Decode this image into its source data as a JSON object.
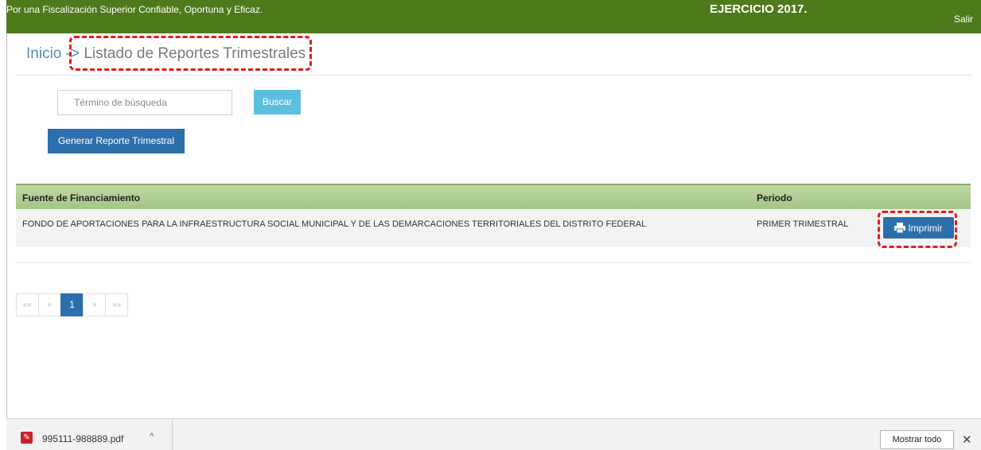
{
  "header": {
    "slogan": "Por una Fiscalización Superior Confiable, Oportuna y Eficaz.",
    "ejercicio": "EJERCICIO 2017.",
    "logout_label": "Salir",
    "background_color": "#4f7a1c"
  },
  "breadcrumb": {
    "home": "Inicio",
    "separator": "->",
    "current": "Listado de Reportes Trimestrales"
  },
  "search": {
    "placeholder": "Término de búsqueda",
    "value": "",
    "button_label": "Buscar"
  },
  "actions": {
    "generate_label": "Generar Reporte Trimestral"
  },
  "table": {
    "columns": [
      "Fuente de Financiamiento",
      "Periodo"
    ],
    "rows": [
      {
        "fuente": "FONDO DE APORTACIONES PARA LA INFRAESTRUCTURA SOCIAL MUNICIPAL Y DE LAS DEMARCACIONES TERRITORIALES DEL DISTRITO FEDERAL",
        "periodo": "PRIMER TRIMESTRAL",
        "action_label": "Imprimir",
        "action_icon": "printer-icon"
      }
    ]
  },
  "pagination": {
    "first": "««",
    "prev": "«",
    "current": "1",
    "next": "»",
    "last": "»»"
  },
  "download_bar": {
    "file_name": "995111-988889.pdf",
    "show_all_label": "Mostrar todo",
    "close_symbol": "✕",
    "caret_symbol": "^"
  },
  "colors": {
    "primary": "#2d6fac",
    "info": "#5bc0de",
    "table_header": "#a4c585",
    "highlight": "#e01c1c"
  }
}
